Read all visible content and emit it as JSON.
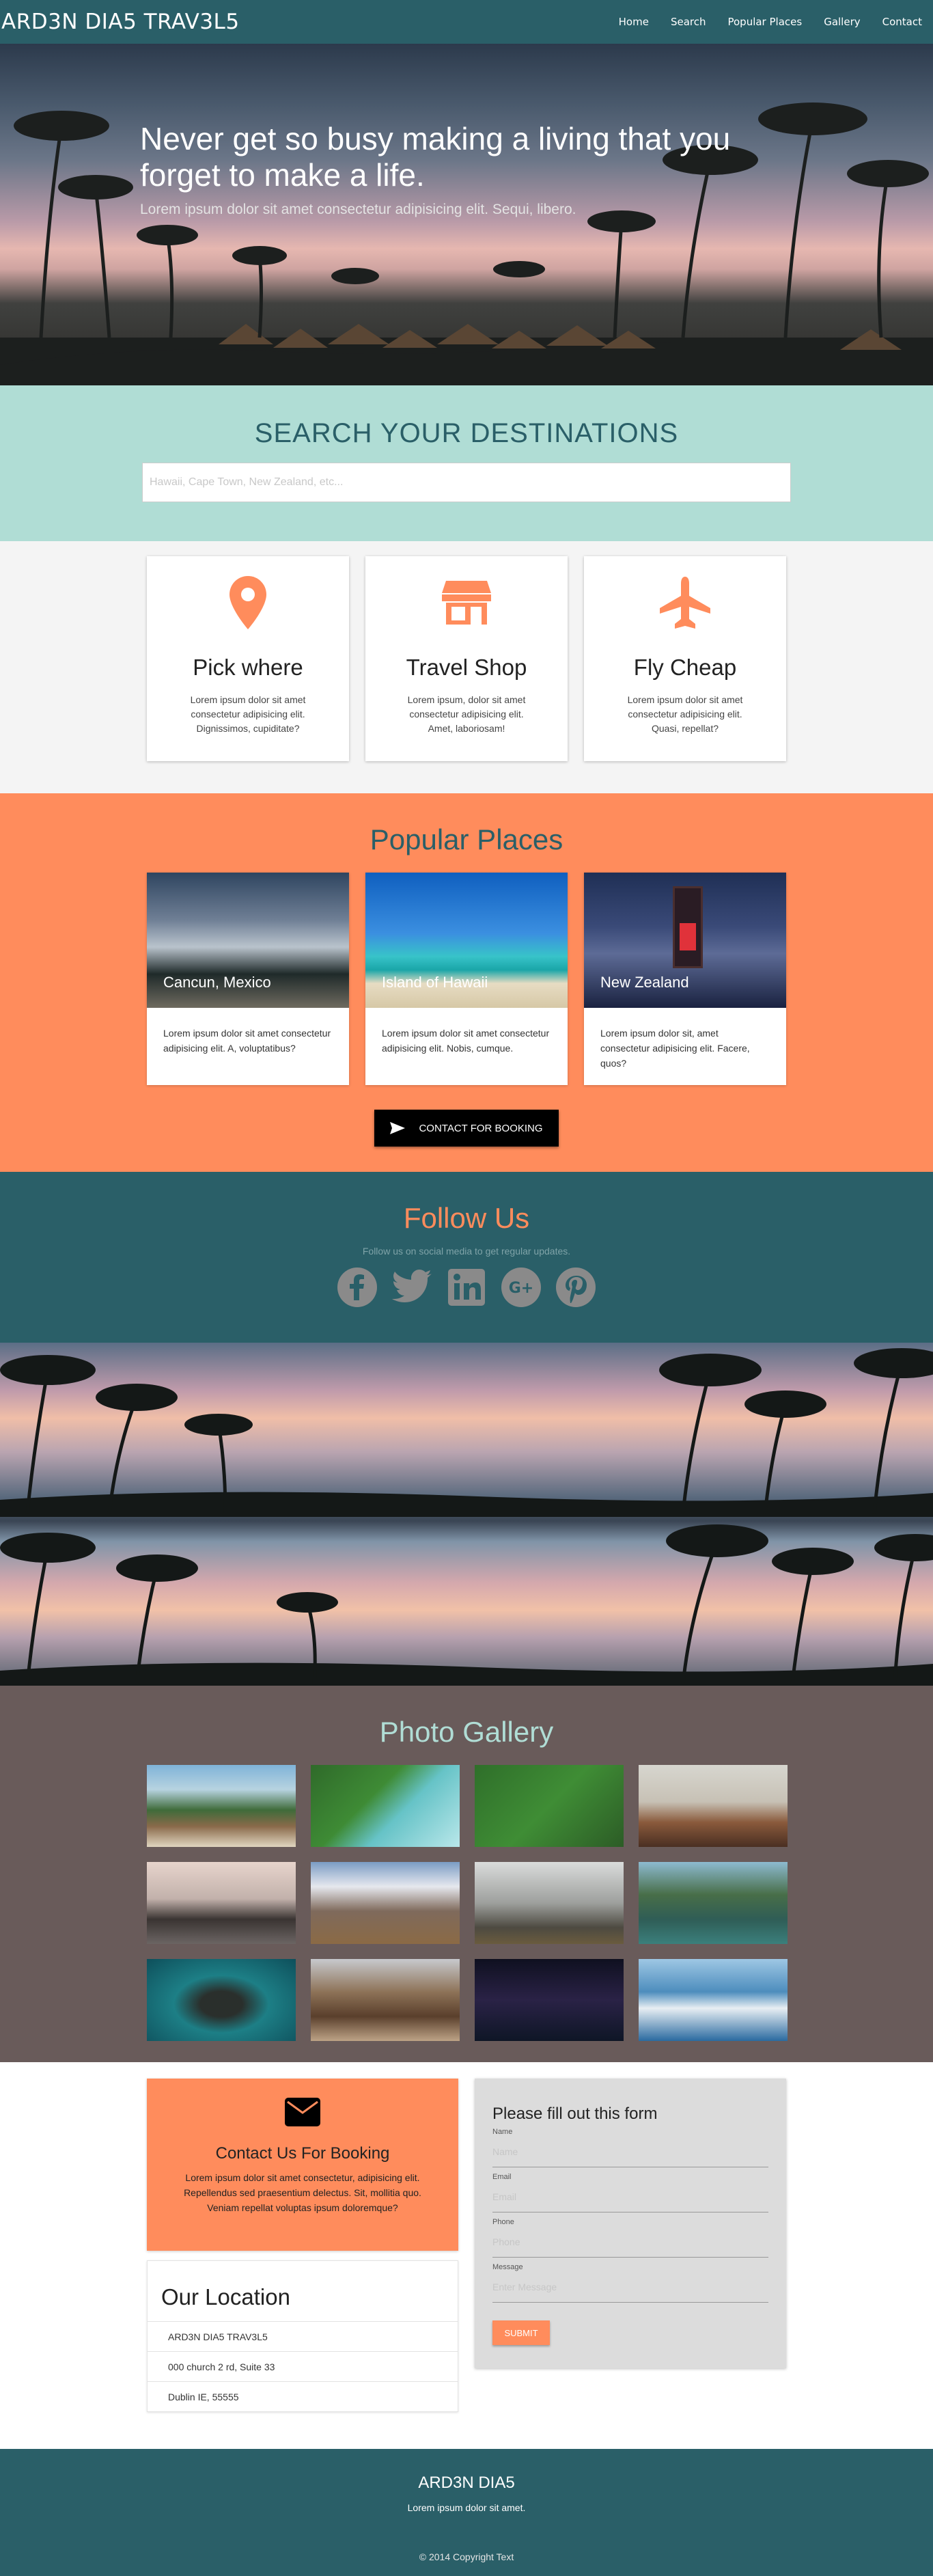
{
  "nav": {
    "brand": "ARD3N DIA5 TRAV3L5",
    "links": [
      "Home",
      "Search",
      "Popular Places",
      "Gallery",
      "Contact"
    ]
  },
  "hero": {
    "title": "Never get so busy making a living that you forget to make a life.",
    "subtitle": "Lorem ipsum dolor sit amet consectetur adipisicing elit. Sequi, libero."
  },
  "search": {
    "heading": "SEARCH YOUR DESTINATIONS",
    "placeholder": "Hawaii, Cape Town, New Zealand, etc..."
  },
  "features": [
    {
      "icon": "map-pin-icon",
      "title": "Pick where",
      "text": "Lorem ipsum dolor sit amet consectetur adipisicing elit. Dignissimos, cupiditate?"
    },
    {
      "icon": "store-icon",
      "title": "Travel Shop",
      "text": "Lorem ipsum, dolor sit amet consectetur adipisicing elit. Amet, laboriosam!"
    },
    {
      "icon": "airplane-icon",
      "title": "Fly Cheap",
      "text": "Lorem ipsum dolor sit amet consectetur adipisicing elit. Quasi, repellat?"
    }
  ],
  "popular": {
    "heading": "Popular Places",
    "places": [
      {
        "name": "Cancun, Mexico",
        "text": "Lorem ipsum dolor sit amet consectetur adipisicing elit. A, voluptatibus?"
      },
      {
        "name": "Island of Hawaii",
        "text": "Lorem ipsum dolor sit amet consectetur adipisicing elit. Nobis, cumque."
      },
      {
        "name": "New Zealand",
        "text": "Lorem ipsum dolor sit, amet consectetur adipisicing elit. Facere, quos?"
      }
    ],
    "button": "CONTACT FOR BOOKING"
  },
  "follow": {
    "heading": "Follow Us",
    "subtitle": "Follow us on social media to get regular updates.",
    "icons": [
      "facebook-icon",
      "twitter-icon",
      "linkedin-icon",
      "google-plus-icon",
      "pinterest-icon"
    ]
  },
  "gallery": {
    "heading": "Photo Gallery"
  },
  "contact": {
    "card_title": "Contact Us For Booking",
    "card_text": "Lorem ipsum dolor sit amet consectetur, adipisicing elit. Repellendus sed praesentium delectus. Sit, mollitia quo. Veniam repellat voluptas ipsum doloremque?",
    "location_title": "Our Location",
    "location_lines": [
      "ARD3N DIA5 TRAV3L5",
      "000 church 2 rd, Suite 33",
      "Dublin IE, 55555"
    ],
    "form_title": "Please fill out this form",
    "fields": [
      {
        "label": "Name",
        "placeholder": "Name"
      },
      {
        "label": "Email",
        "placeholder": "Email"
      },
      {
        "label": "Phone",
        "placeholder": "Phone"
      },
      {
        "label": "Message",
        "placeholder": "Enter Message"
      }
    ],
    "submit": "SUBMIT"
  },
  "footer": {
    "brand": "ARD3N DIA5",
    "tagline": "Lorem ipsum dolor sit amet.",
    "copyright": "© 2014 Copyright Text"
  },
  "colors": {
    "teal": "#2a5f68",
    "mint": "#b0ddd5",
    "orange": "#ff8c5c",
    "taupe": "#695b5a"
  }
}
